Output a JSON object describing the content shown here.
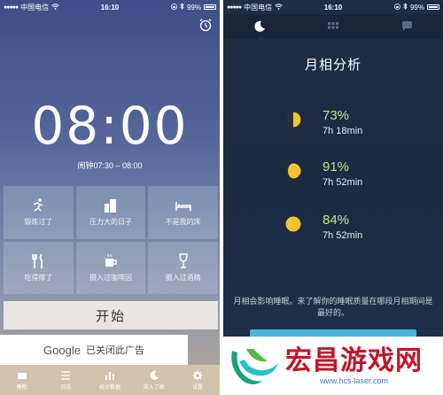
{
  "left": {
    "status": {
      "carrier": "中国电信",
      "time": "16:10",
      "battery": "99%"
    },
    "clock": {
      "hours": "08",
      "sep": ":",
      "minutes": "00"
    },
    "alarm_range": "闹钟07:30 – 08:00",
    "tiles": [
      {
        "label": "锻炼过了",
        "icon": "running-icon"
      },
      {
        "label": "压力大的日子",
        "icon": "buildings-icon"
      },
      {
        "label": "不是我的床",
        "icon": "bed-icon"
      },
      {
        "label": "吃得撑了",
        "icon": "fork-knife-icon"
      },
      {
        "label": "摄入过咖啡因",
        "icon": "coffee-cup-icon"
      },
      {
        "label": "摄入过酒精",
        "icon": "wine-glass-icon"
      }
    ],
    "start_label": "开始",
    "ad": {
      "brand": "Google",
      "text": "已关闭此广告"
    },
    "tabs": [
      {
        "label": "睡眠",
        "icon": "sleep-icon"
      },
      {
        "label": "日志",
        "icon": "list-icon"
      },
      {
        "label": "统计数据",
        "icon": "bar-chart-icon"
      },
      {
        "label": "深入了解",
        "icon": "moon-icon"
      },
      {
        "label": "设置",
        "icon": "gear-icon"
      }
    ]
  },
  "right": {
    "status": {
      "carrier": "中国电信",
      "time": "16:10",
      "battery": "99%"
    },
    "title": "月相分析",
    "phases": [
      {
        "percent": "73%",
        "duration": "7h 18min",
        "moon": "half-moon-icon"
      },
      {
        "percent": "91%",
        "duration": "7h 52min",
        "moon": "gibbous-moon-icon"
      },
      {
        "percent": "84%",
        "duration": "7h 52min",
        "moon": "full-moon-icon"
      }
    ],
    "note": "月相会影响睡眠。来了解你的睡眠质量在哪段月相期间是最好的。"
  },
  "watermark": {
    "title": "宏昌游戏网",
    "url": "www.hcs-laser.com"
  },
  "colors": {
    "moon": "#f2c230",
    "percent": "#c7e08a",
    "right_bg": "#1e2c44",
    "accent": "#4db4d6",
    "watermark": "#c0162a"
  }
}
